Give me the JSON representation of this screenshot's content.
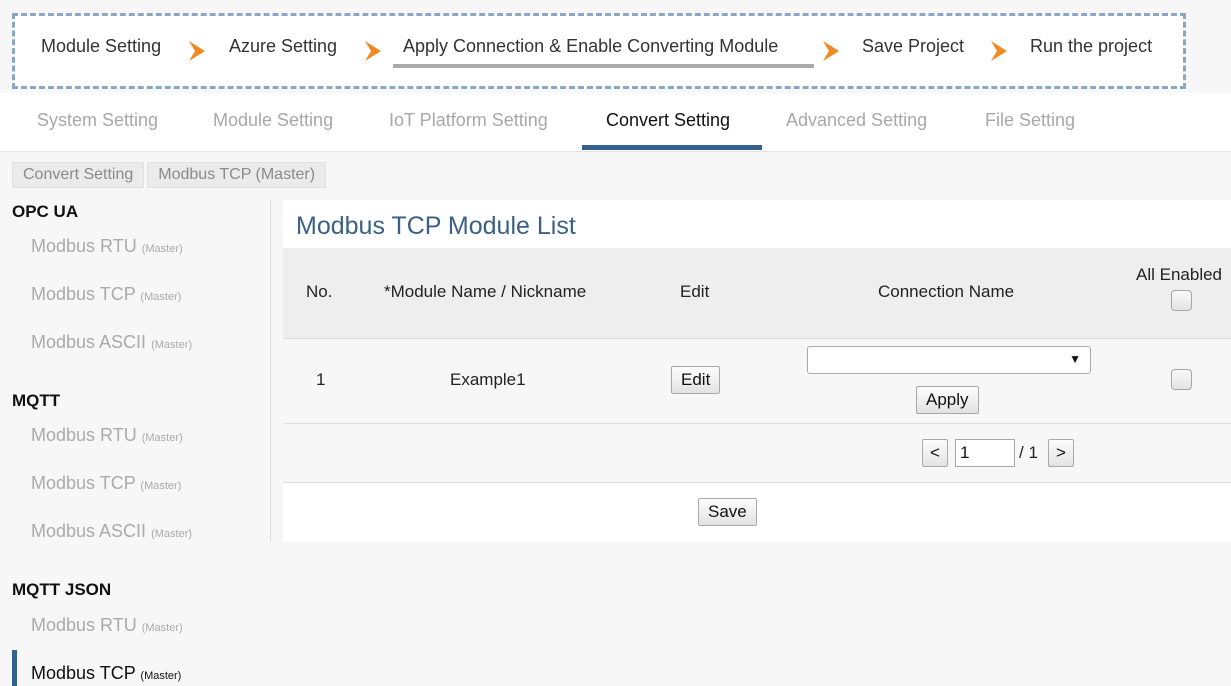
{
  "wizard": {
    "steps": [
      "Module Setting",
      "Azure Setting",
      "Apply Connection & Enable Converting Module",
      "Save Project",
      "Run the project"
    ],
    "arrow_icon": "chevron-right-icon",
    "arrow_color": "#f08a24",
    "border_color": "#8aa6c9"
  },
  "tabs": [
    {
      "label": "System Setting",
      "active": false
    },
    {
      "label": "Module Setting",
      "active": false
    },
    {
      "label": "IoT Platform Setting",
      "active": false
    },
    {
      "label": "Convert Setting",
      "active": true
    },
    {
      "label": "Advanced Setting",
      "active": false
    },
    {
      "label": "File Setting",
      "active": false
    }
  ],
  "breadcrumb": [
    "Convert Setting",
    "Modbus TCP (Master)"
  ],
  "sidebar": {
    "groups": [
      {
        "heading": "OPC UA",
        "items": [
          {
            "label": "Modbus RTU",
            "sub": "(Master)"
          },
          {
            "label": "Modbus TCP",
            "sub": "(Master)"
          },
          {
            "label": "Modbus ASCII",
            "sub": "(Master)"
          }
        ]
      },
      {
        "heading": "MQTT",
        "items": [
          {
            "label": "Modbus RTU",
            "sub": "(Master)"
          },
          {
            "label": "Modbus TCP",
            "sub": "(Master)"
          },
          {
            "label": "Modbus ASCII",
            "sub": "(Master)"
          }
        ]
      },
      {
        "heading": "MQTT JSON",
        "items": [
          {
            "label": "Modbus RTU",
            "sub": "(Master)"
          },
          {
            "label": "Modbus TCP",
            "sub": "(Master)",
            "active": true
          }
        ]
      }
    ]
  },
  "main": {
    "title": "Modbus TCP Module List",
    "columns": [
      "No.",
      "*Module Name / Nickname",
      "Edit",
      "Connection Name",
      "All Enabled"
    ],
    "rows": [
      {
        "no": "1",
        "name": "Example1",
        "edit_label": "Edit",
        "connection": "",
        "apply_label": "Apply"
      }
    ],
    "pager": {
      "prev": "<",
      "page": "1",
      "total": "/ 1",
      "next": ">"
    },
    "save_label": "Save"
  },
  "colors": {
    "accent": "#34628f",
    "title": "#3a6185",
    "inactive_text": "#aaaaaa"
  }
}
